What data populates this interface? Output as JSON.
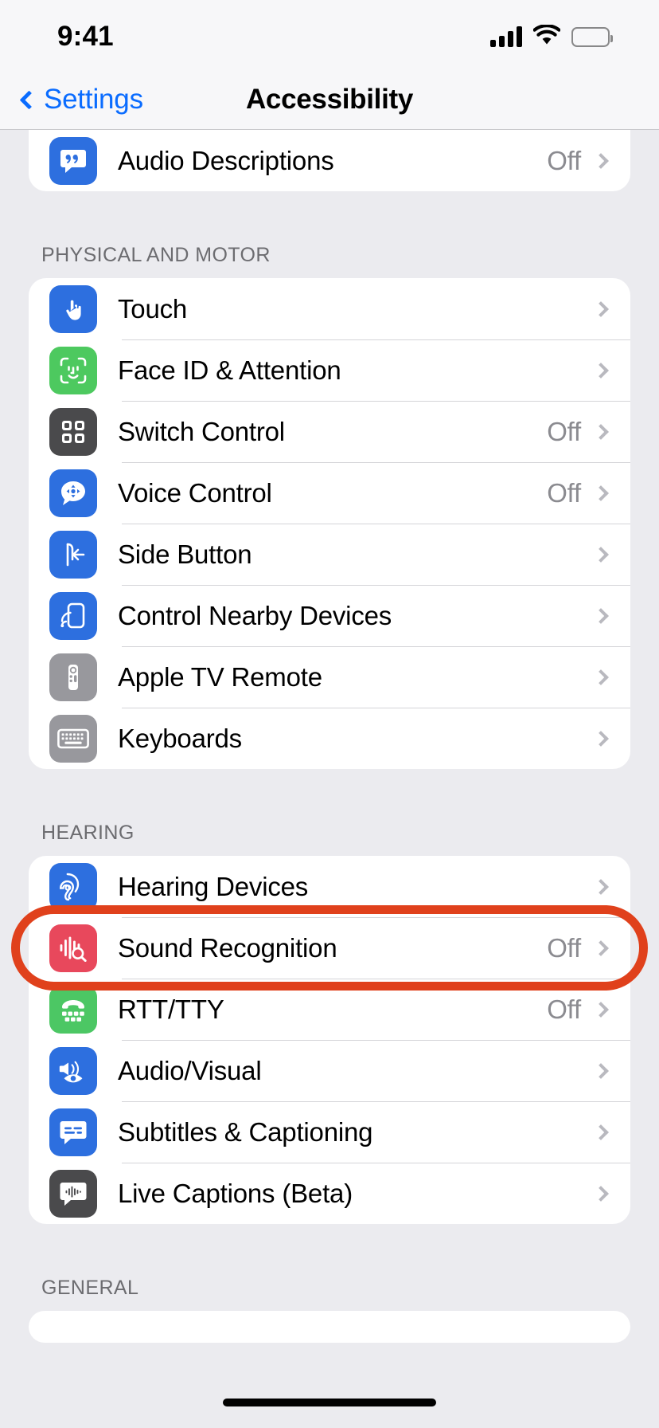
{
  "status_bar": {
    "time": "9:41",
    "cellular_icon": "cellular-bars-icon",
    "wifi_icon": "wifi-icon",
    "battery_icon": "battery-full-icon"
  },
  "nav": {
    "back_label": "Settings",
    "title": "Accessibility",
    "back_icon": "chevron-left-icon",
    "accent_color": "#0a6cff"
  },
  "colors": {
    "page_background": "#ebebef",
    "group_background": "#ffffff",
    "section_header": "#6c6c70",
    "value_text": "#8b8b90",
    "highlight_ring": "#e0411c"
  },
  "partial_group": {
    "rows": [
      {
        "label": "Audio Descriptions",
        "value": "Off",
        "icon": "audio-descriptions-icon",
        "icon_color": "#2d6fdf"
      }
    ]
  },
  "sections": [
    {
      "header": "PHYSICAL AND MOTOR",
      "rows": [
        {
          "label": "Touch",
          "value": "",
          "icon": "touch-hand-icon",
          "icon_color": "#2d6fdf"
        },
        {
          "label": "Face ID & Attention",
          "value": "",
          "icon": "face-id-icon",
          "icon_color": "#4dc95f"
        },
        {
          "label": "Switch Control",
          "value": "Off",
          "icon": "switch-control-icon",
          "icon_color": "#4a4a4c"
        },
        {
          "label": "Voice Control",
          "value": "Off",
          "icon": "voice-control-icon",
          "icon_color": "#2d6fdf"
        },
        {
          "label": "Side Button",
          "value": "",
          "icon": "side-button-icon",
          "icon_color": "#2d6fdf"
        },
        {
          "label": "Control Nearby Devices",
          "value": "",
          "icon": "control-nearby-devices-icon",
          "icon_color": "#2d6fdf"
        },
        {
          "label": "Apple TV Remote",
          "value": "",
          "icon": "apple-tv-remote-icon",
          "icon_color": "#98989d"
        },
        {
          "label": "Keyboards",
          "value": "",
          "icon": "keyboard-icon",
          "icon_color": "#98989d"
        }
      ]
    },
    {
      "header": "HEARING",
      "rows": [
        {
          "label": "Hearing Devices",
          "value": "",
          "icon": "hearing-devices-ear-icon",
          "icon_color": "#2d6fdf"
        },
        {
          "label": "Sound Recognition",
          "value": "Off",
          "icon": "sound-recognition-icon",
          "icon_color": "#e8485c",
          "highlighted": true
        },
        {
          "label": "RTT/TTY",
          "value": "Off",
          "icon": "rtt-tty-icon",
          "icon_color": "#4dc95f"
        },
        {
          "label": "Audio/Visual",
          "value": "",
          "icon": "audio-visual-icon",
          "icon_color": "#2d6fdf"
        },
        {
          "label": "Subtitles & Captioning",
          "value": "",
          "icon": "subtitles-captioning-icon",
          "icon_color": "#2d6fdf"
        },
        {
          "label": "Live Captions (Beta)",
          "value": "",
          "icon": "live-captions-icon",
          "icon_color": "#4a4a4c"
        }
      ]
    },
    {
      "header": "GENERAL",
      "rows": []
    }
  ]
}
